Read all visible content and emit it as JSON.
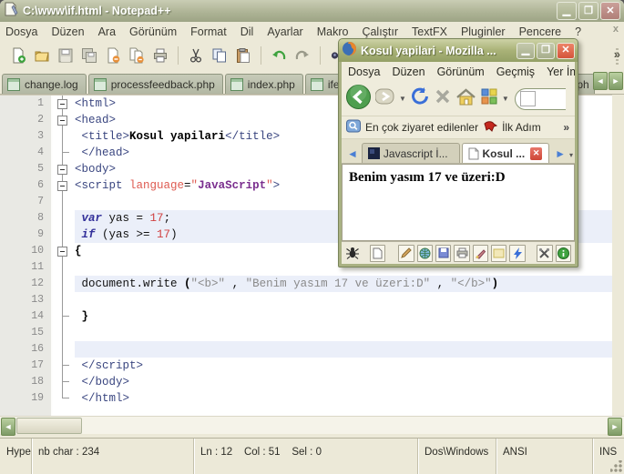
{
  "npp": {
    "title": "C:\\www\\if.html - Notepad++",
    "menu": [
      "Dosya",
      "Düzen",
      "Ara",
      "Görünüm",
      "Format",
      "Dil",
      "Ayarlar",
      "Makro",
      "Çalıştır",
      "TextFX",
      "Pluginler",
      "Pencere",
      "?"
    ],
    "menu_close": "x",
    "toolbar_overflow": "»",
    "toolbar_icons": [
      "new-file-icon",
      "open-file-icon",
      "save-icon",
      "save-all-icon",
      "close-file-icon",
      "close-all-icon",
      "print-icon",
      "cut-icon",
      "copy-icon",
      "paste-icon",
      "undo-icon",
      "redo-icon",
      "find-icon",
      "replace-icon"
    ],
    "tabs": [
      {
        "label": "change.log"
      },
      {
        "label": "processfeedback.php"
      },
      {
        "label": "index.php"
      },
      {
        "label": "ifelse.php"
      }
    ],
    "tab_overflow_label": "x.ph",
    "tab_scroll": {
      "left": "◄",
      "right": "►"
    },
    "editor": {
      "lines": [
        {
          "n": 1,
          "fold": "box",
          "hl": false,
          "s": [
            [
              "<html>",
              "tag"
            ]
          ]
        },
        {
          "n": 2,
          "fold": "box",
          "hl": false,
          "s": [
            [
              "<head>",
              "tag"
            ]
          ]
        },
        {
          "n": 3,
          "fold": "line",
          "hl": false,
          "s": [
            [
              " ",
              "pl"
            ],
            [
              "<title>",
              "tag"
            ],
            [
              "Kosul yapilari",
              "bb"
            ],
            [
              "</title>",
              "tag"
            ]
          ]
        },
        {
          "n": 4,
          "fold": "tick",
          "hl": false,
          "s": [
            [
              " ",
              "pl"
            ],
            [
              "</head>",
              "tag"
            ]
          ]
        },
        {
          "n": 5,
          "fold": "box",
          "hl": false,
          "s": [
            [
              "<body>",
              "tag"
            ]
          ]
        },
        {
          "n": 6,
          "fold": "box",
          "hl": false,
          "s": [
            [
              "<script ",
              "tag"
            ],
            [
              "language",
              "attr"
            ],
            [
              "=",
              "pl"
            ],
            [
              "\"",
              "attr"
            ],
            [
              "JavaScript",
              "pur"
            ],
            [
              "\"",
              "attr"
            ],
            [
              ">",
              "tag"
            ]
          ]
        },
        {
          "n": 7,
          "fold": "line",
          "hl": false,
          "s": []
        },
        {
          "n": 8,
          "fold": "line",
          "hl": true,
          "s": [
            [
              " ",
              "pl"
            ],
            [
              "var",
              "kw"
            ],
            [
              " yas = ",
              "pl"
            ],
            [
              "17",
              "num"
            ],
            [
              ";",
              "pl"
            ]
          ]
        },
        {
          "n": 9,
          "fold": "line",
          "hl": true,
          "s": [
            [
              " ",
              "pl"
            ],
            [
              "if",
              "kw"
            ],
            [
              " (yas >= ",
              "pl"
            ],
            [
              "17",
              "num"
            ],
            [
              ")",
              "pl"
            ]
          ]
        },
        {
          "n": 10,
          "fold": "box",
          "hl": false,
          "s": [
            [
              "{",
              "bb"
            ]
          ]
        },
        {
          "n": 11,
          "fold": "line",
          "hl": false,
          "s": []
        },
        {
          "n": 12,
          "fold": "line",
          "hl": true,
          "s": [
            [
              " document.write ",
              "pl"
            ],
            [
              "(",
              "bb"
            ],
            [
              "\"<b>\"",
              "str"
            ],
            [
              " , ",
              "pl"
            ],
            [
              "\"Benim yasım 17 ve üzeri:D\"",
              "str"
            ],
            [
              " , ",
              "pl"
            ],
            [
              "\"</b>\"",
              "str"
            ],
            [
              ")",
              "bb"
            ]
          ]
        },
        {
          "n": 13,
          "fold": "line",
          "hl": false,
          "s": []
        },
        {
          "n": 14,
          "fold": "tick",
          "hl": false,
          "s": [
            [
              " ",
              "pl"
            ],
            [
              "}",
              "bb"
            ]
          ]
        },
        {
          "n": 15,
          "fold": "line",
          "hl": false,
          "s": []
        },
        {
          "n": 16,
          "fold": "line",
          "hl": true,
          "s": []
        },
        {
          "n": 17,
          "fold": "tick",
          "hl": false,
          "s": [
            [
              " ",
              "pl"
            ],
            [
              "</script>",
              "tag"
            ]
          ]
        },
        {
          "n": 18,
          "fold": "tick",
          "hl": false,
          "s": [
            [
              " ",
              "pl"
            ],
            [
              "</body>",
              "tag"
            ]
          ]
        },
        {
          "n": 19,
          "fold": "end",
          "hl": false,
          "s": [
            [
              " ",
              "pl"
            ],
            [
              "</html>",
              "tag"
            ]
          ]
        }
      ]
    },
    "statusbar": {
      "doctype": "Hype",
      "length": "nb char : 234",
      "position": "Ln : 12    Col : 51    Sel : 0",
      "eol": "Dos\\Windows",
      "encoding": "ANSI",
      "insert_mode": "INS"
    }
  },
  "firefox": {
    "title": "Kosul yapilari - Mozilla ...",
    "menu": [
      "Dosya",
      "Düzen",
      "Görünüm",
      "Geçmiş",
      "Yer İmleri"
    ],
    "bookmarks": [
      {
        "label": "En çok ziyaret edilenler"
      },
      {
        "label": "İlk Adım"
      }
    ],
    "bookmarks_overflow": "»",
    "tabs": [
      {
        "label": "Javascript İ...",
        "active": false
      },
      {
        "label": "Kosul ...",
        "active": true
      }
    ],
    "tab_scroll": {
      "left": "◄",
      "right": "►",
      "list": "▾"
    },
    "nav_icons": [
      "back-icon",
      "forward-icon",
      "dropdown-caret-icon",
      "refresh-icon",
      "stop-icon",
      "home-icon",
      "grid-icon",
      "dropdown-caret-icon"
    ],
    "status_icons": [
      "bug-icon",
      "new-page-icon",
      "edit-pencil-icon",
      "globe-icon",
      "save-icon",
      "print-icon",
      "draw-icon",
      "frame-icon",
      "lightning-icon",
      "tools-icon",
      "info-icon"
    ],
    "content_text": "Benim yasım 17 ve üzeri:D"
  },
  "colors": {
    "titlebar_olive": "#A9B183",
    "close_red": "#D4543B",
    "line_highlight": "#EBEFF9",
    "tag_blue": "#3A4680",
    "string_grey": "#8A8A8A",
    "number_red": "#D04040",
    "keyword_purple": "#33309A"
  }
}
